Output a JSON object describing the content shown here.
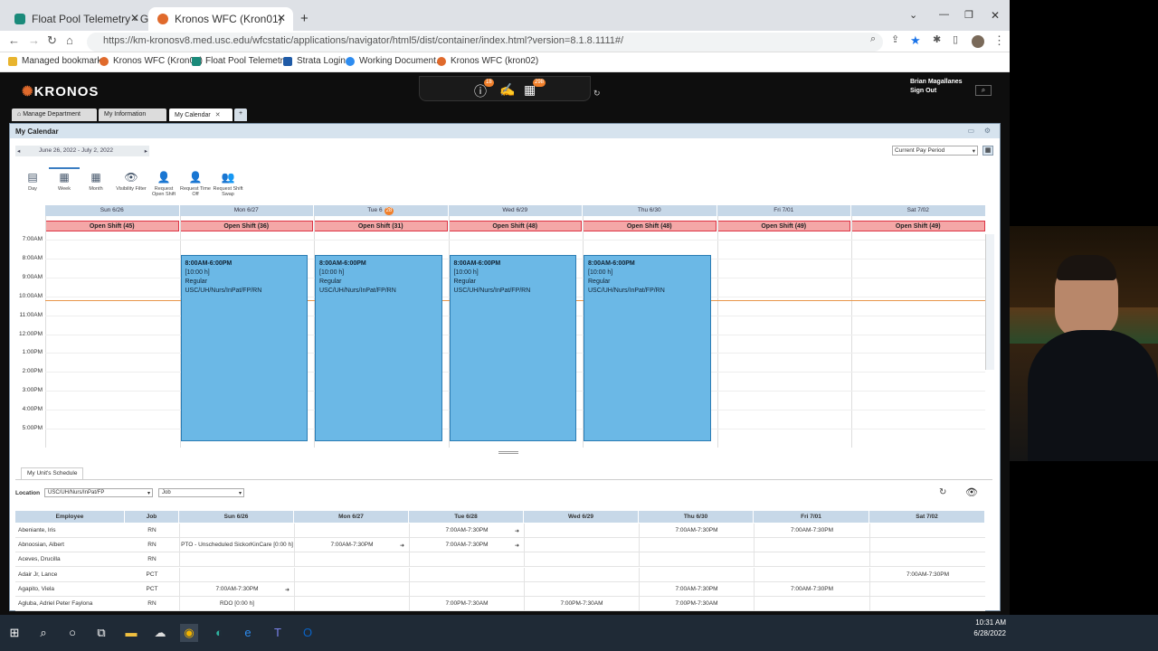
{
  "browser": {
    "tabs": [
      {
        "label": "Float Pool Telemetry - Guideline",
        "close": "✕"
      },
      {
        "label": "Kronos WFC (Kron01)",
        "close": "✕"
      }
    ],
    "new_tab": "+",
    "url": "https://km-kronosv8.med.usc.edu/wfcstatic/applications/navigator/html5/dist/container/index.html?version=8.1.8.1111#/",
    "bookmarks": [
      "Managed bookmarks",
      "Kronos WFC (Kron01)",
      "Float Pool Telemetr...",
      "Strata Login",
      "Working Document...",
      "Kronos WFC (kron02)"
    ]
  },
  "kronos": {
    "logo": "KRONOS",
    "badges": {
      "alerts": "18",
      "calendar": "298"
    },
    "user": {
      "name": "Brian Magallanes",
      "signout": "Sign Out"
    },
    "tabs": [
      "Manage Department",
      "My Information",
      "My Calendar"
    ],
    "tab_add": "+",
    "panel_title": "My Calendar",
    "date_range": "June 26, 2022 - July 2, 2022",
    "pay_period": "Current Pay Period",
    "toolbar": [
      {
        "label": "Day",
        "icon": "calendar-day-icon",
        "glyph": "▤"
      },
      {
        "label": "Week",
        "icon": "calendar-week-icon",
        "glyph": "▦"
      },
      {
        "label": "Month",
        "icon": "calendar-month-icon",
        "glyph": "▦"
      },
      {
        "label": "Visibility Filter",
        "icon": "eye-icon",
        "glyph": "👁"
      },
      {
        "label": "Request Open Shift",
        "icon": "person-shift-icon",
        "glyph": "👤"
      },
      {
        "label": "Request Time Off",
        "icon": "person-timeoff-icon",
        "glyph": "👤"
      },
      {
        "label": "Request Shift Swap",
        "icon": "people-swap-icon",
        "glyph": "👥"
      }
    ],
    "days": [
      "Sun 6/26",
      "Mon 6/27",
      "Tue 6",
      "Wed 6/29",
      "Thu 6/30",
      "Fri 7/01",
      "Sat 7/02"
    ],
    "today_badge": "28",
    "open_shifts": [
      "Open Shift (45)",
      "Open Shift (36)",
      "Open Shift (31)",
      "Open Shift (48)",
      "Open Shift (48)",
      "Open Shift (49)",
      "Open Shift (49)"
    ],
    "hours": [
      "7:00AM",
      "8:00AM",
      "9:00AM",
      "10:00AM",
      "11:00AM",
      "12:00PM",
      "1:00PM",
      "2:00PM",
      "3:00PM",
      "4:00PM",
      "5:00PM"
    ],
    "shifts": [
      {
        "day": 1,
        "time": "8:00AM-6:00PM",
        "hours": "[10:00 h]",
        "type": "Regular",
        "job": "USC/UH/Nurs/InPat/FP/RN"
      },
      {
        "day": 2,
        "time": "8:00AM-6:00PM",
        "hours": "[10:00 h]",
        "type": "Regular",
        "job": "USC/UH/Nurs/InPat/FP/RN"
      },
      {
        "day": 3,
        "time": "8:00AM-6:00PM",
        "hours": "[10:00 h]",
        "type": "Regular",
        "job": "USC/UH/Nurs/InPat/FP/RN"
      },
      {
        "day": 4,
        "time": "8:00AM-6:00PM",
        "hours": "[10:00 h]",
        "type": "Regular",
        "job": "USC/UH/Nurs/InPat/FP/RN"
      }
    ],
    "unit_tab": "My Unit's Schedule",
    "location_label": "Location",
    "location_value": "USC/UH/Nurs/InPat/FP",
    "job_value": "Job",
    "sched_headers": [
      "Employee",
      "Job",
      "Sun 6/26",
      "Mon 6/27",
      "Tue 6/28",
      "Wed 6/29",
      "Thu 6/30",
      "Fri 7/01",
      "Sat 7/02"
    ],
    "rows": [
      {
        "name": "Abeniante, Iris",
        "job": "RN",
        "cells": [
          "",
          "",
          "7:00AM-7:30PM",
          "",
          "7:00AM-7:30PM",
          "7:00AM-7:30PM",
          ""
        ],
        "arrows": [
          2
        ]
      },
      {
        "name": "Abnoosian, Albert",
        "job": "RN",
        "cells": [
          "PTO - Unscheduled SickorKinCare [0:00 h]",
          "7:00AM-7:30PM",
          "7:00AM-7:30PM",
          "",
          "",
          "",
          ""
        ],
        "arrows": [
          1,
          2
        ]
      },
      {
        "name": "Aceves, Drucilla",
        "job": "RN",
        "cells": [
          "",
          "",
          "",
          "",
          "",
          "",
          ""
        ],
        "arrows": []
      },
      {
        "name": "Adair Jr, Lance",
        "job": "PCT",
        "cells": [
          "",
          "",
          "",
          "",
          "",
          "",
          "7:00AM-7:30PM"
        ],
        "arrows": []
      },
      {
        "name": "Agapito, Viela",
        "job": "PCT",
        "cells": [
          "7:00AM-7:30PM",
          "",
          "",
          "",
          "7:00AM-7:30PM",
          "7:00AM-7:30PM",
          ""
        ],
        "arrows": [
          0
        ]
      },
      {
        "name": "Agluba, Adriel Peter Faylona",
        "job": "RN",
        "cells": [
          "RDO [0:00 h]",
          "",
          "7:00PM-7:30AM",
          "7:00PM-7:30AM",
          "7:00PM-7:30AM",
          "",
          ""
        ],
        "arrows": []
      }
    ]
  },
  "taskbar": {
    "time": "10:31 AM",
    "date": "6/28/2022"
  }
}
